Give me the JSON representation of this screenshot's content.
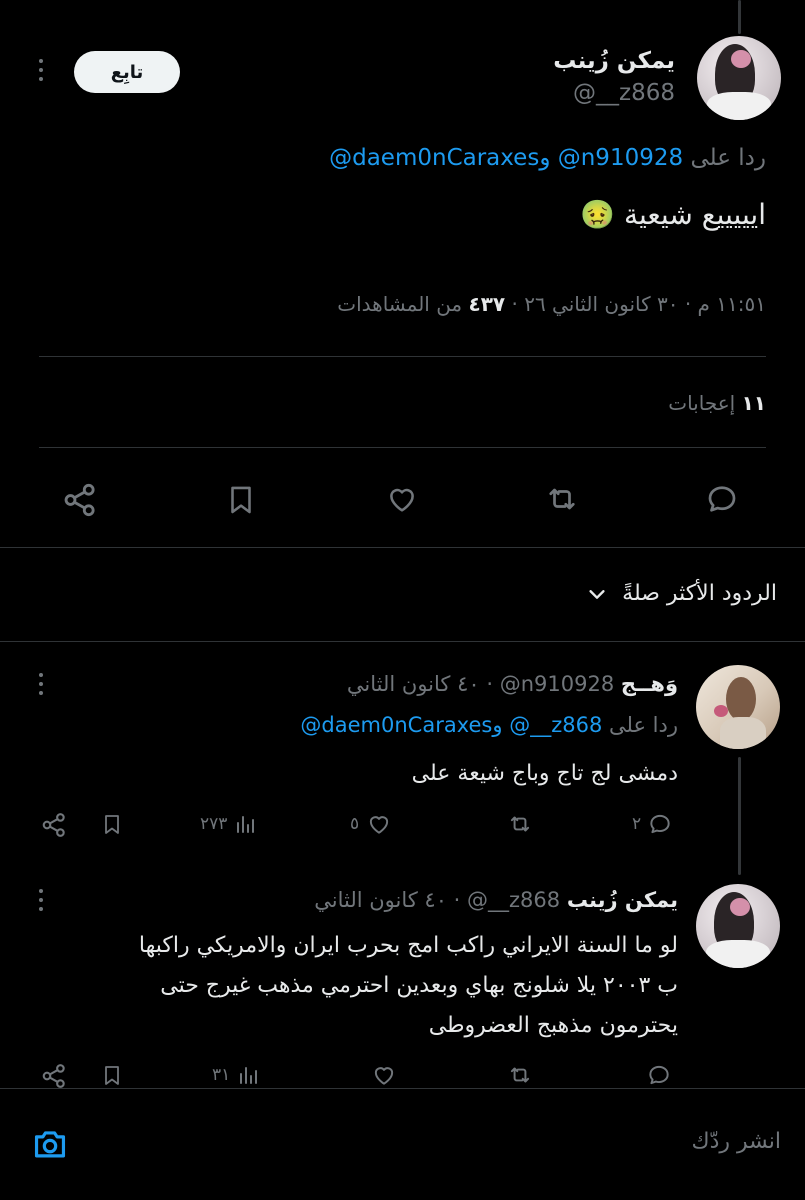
{
  "main_tweet": {
    "display_name": "يمكن زُينب",
    "handle": "@__z868",
    "follow_label": "تابِع",
    "reply_prefix": "ردا على",
    "reply_mention_1": "@n910928",
    "reply_and": "و",
    "reply_mention_2": "@daem0nCaraxes",
    "text": "ايييييع شيعية",
    "emoji": "🤢",
    "timestamp": "١١:٥١ م · ٣٠ كانون الثاني ٢٦ ·",
    "views_count": "٤٣٧",
    "views_label": "من المشاهدات",
    "likes_count": "١١",
    "likes_label": "إعجابات"
  },
  "sort": {
    "label": "الردود الأكثر صلةً"
  },
  "replies": [
    {
      "display_name": "وَهــج",
      "handle": "@n910928",
      "time": "· ٤٠ كانون الثاني",
      "reply_prefix": "ردا على",
      "reply_mention_1": "@__z868",
      "reply_and": "و",
      "reply_mention_2": "@daem0nCaraxes",
      "text": "دمشى لج تاج وباج شيعة على",
      "stats": {
        "replies": "٢",
        "likes": "٥",
        "views": "٢٧٣"
      }
    },
    {
      "display_name": "يمكن زُينب",
      "handle": "@__z868",
      "time": "· ٤٠ كانون الثاني",
      "text_lines": [
        "لو ما السنة الايراني راكب امج بحرب ايران والامريكي راكبها",
        "ب ٢٠٠٣ يلا شلونج بهاي وبعدين احترمي مذهب غيرج حتى",
        "يحترمون مذهبج العضروطى"
      ],
      "stats": {
        "replies": "",
        "likes": "",
        "views": "٣١"
      }
    }
  ],
  "composer": {
    "placeholder": "انشر ردّك"
  },
  "colors": {
    "background": "#000000",
    "text": "#e7e9ea",
    "muted": "#71767b",
    "link": "#1d9bf0",
    "divider": "#2f3336"
  }
}
